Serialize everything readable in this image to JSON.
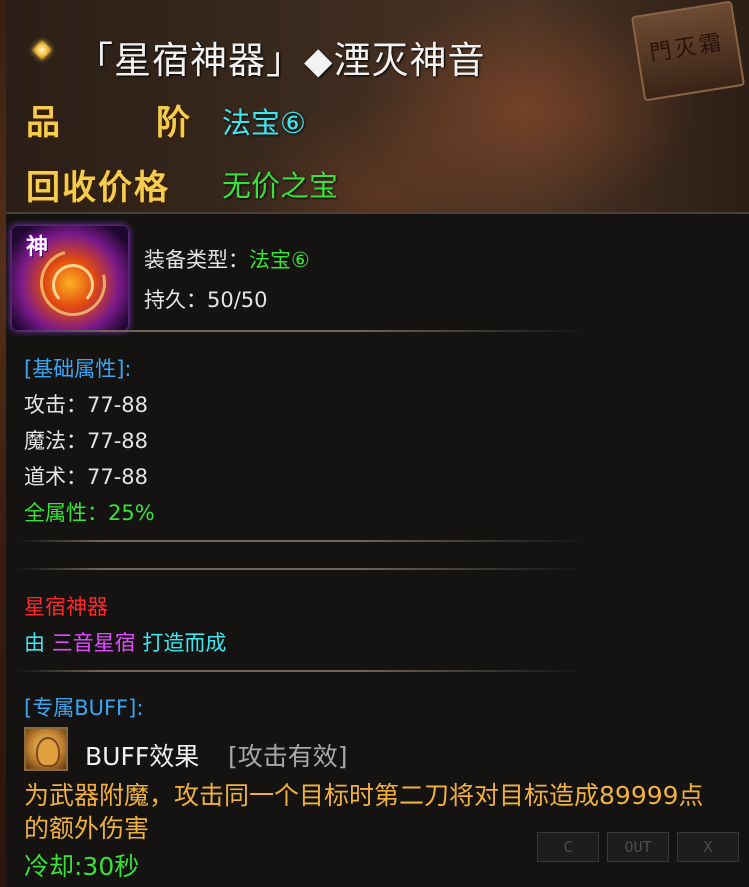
{
  "tooltip": {
    "title": "「星宿神器」◆湮灭神音",
    "quality_label": [
      "品",
      "阶"
    ],
    "quality_value": "法宝⑥",
    "price_label": "回收价格",
    "price_value": "无价之宝",
    "plaque_text": "門灭霜",
    "icon_badge": "神"
  },
  "equip": {
    "type_label": "装备类型：",
    "type_value": "法宝⑥",
    "durability_label": "持久：",
    "durability_value": "50/50"
  },
  "base_attrs": {
    "header": "[基础属性]:",
    "items": [
      {
        "label": "攻击：",
        "value": "77-88"
      },
      {
        "label": "魔法：",
        "value": "77-88"
      },
      {
        "label": "道术：",
        "value": "77-88"
      }
    ],
    "all_attr": "全属性：25%"
  },
  "set_info": {
    "name": "星宿神器",
    "craft_prefix": "由 ",
    "craft_source": "三音星宿",
    "craft_suffix": " 打造而成"
  },
  "buff": {
    "header": "[专属BUFF]:",
    "name": "BUFF效果",
    "condition": "[攻击有效]",
    "desc_line1": "为武器附魔，攻击同一个目标时第二刀将对目标造成89999点",
    "desc_line2": "的额外伤害",
    "cooldown": "冷却:30秒"
  },
  "background_buttons": [
    "C",
    "OUT",
    "X"
  ]
}
